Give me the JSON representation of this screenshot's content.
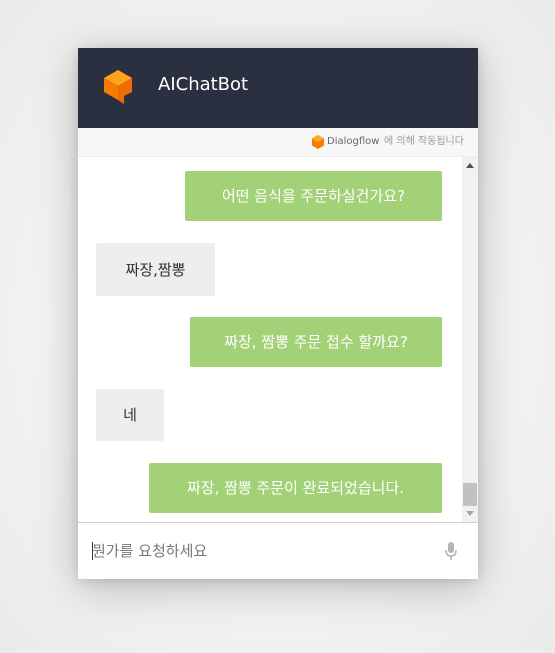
{
  "header": {
    "title": "AIChatBot",
    "logo_icon": "orange-cube-icon",
    "background_color": "#2a303f"
  },
  "powered_by": {
    "brand": "Dialogflow",
    "text": "에 의해 작동됩니다"
  },
  "messages": [
    {
      "sender": "bot",
      "text": "어떤 음식을 주문하실건가요?"
    },
    {
      "sender": "user",
      "text": "짜장,짬뽕"
    },
    {
      "sender": "bot",
      "text": "짜장, 짬뽕 주문 접수 할까요?"
    },
    {
      "sender": "user",
      "text": "네"
    },
    {
      "sender": "bot",
      "text": "짜장, 짬뽕 주문이 완료되었습니다."
    }
  ],
  "input": {
    "placeholder": "뭔가를 요청하세요",
    "value": "",
    "mic_icon": "microphone-icon"
  },
  "colors": {
    "bot_bubble": "#a3d177",
    "user_bubble": "#eeeeee",
    "brand_orange": "#f5840f"
  }
}
